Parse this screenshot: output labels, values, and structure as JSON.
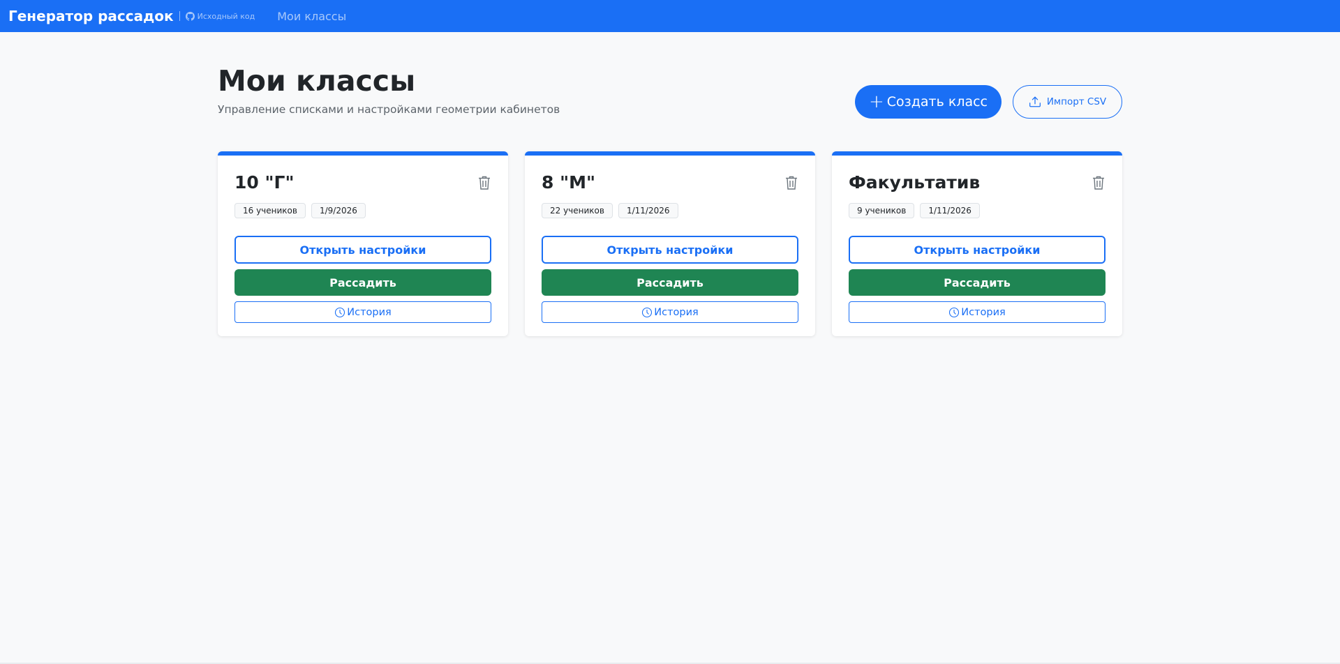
{
  "navbar": {
    "brand": "Генератор рассадок",
    "source_link": "Исходный код",
    "source_icon": "github-icon",
    "nav_link": "Мои классы",
    "bg_color": "#1a6ff5"
  },
  "header": {
    "title": "Мои классы",
    "subtitle": "Управление списками и настройками геометрии кабинетов",
    "create_button": "Создать класс",
    "create_icon": "plus-icon",
    "import_button": "Импорт CSV",
    "import_icon": "upload-icon"
  },
  "cards": [
    {
      "title": "10 \"Г\"",
      "students": "16 учеников",
      "date": "1/9/2026",
      "settings_button": "Открыть настройки",
      "seat_button": "Рассадить",
      "history_button": "История"
    },
    {
      "title": "8 \"М\"",
      "students": "22 учеников",
      "date": "1/11/2026",
      "settings_button": "Открыть настройки",
      "seat_button": "Рассадить",
      "history_button": "История"
    },
    {
      "title": "Факультатив",
      "students": "9 учеников",
      "date": "1/11/2026",
      "settings_button": "Открыть настройки",
      "seat_button": "Рассадить",
      "history_button": "История"
    }
  ],
  "colors": {
    "primary": "#1a6ff5",
    "success": "#1f8553",
    "background": "#f8f9fa"
  }
}
